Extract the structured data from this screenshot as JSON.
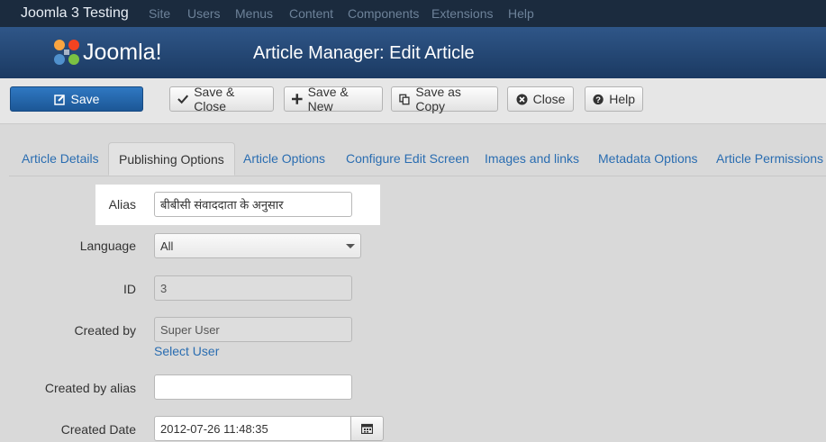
{
  "topnav": {
    "brand": "Joomla 3 Testing",
    "menu": [
      "Site",
      "Users",
      "Menus",
      "Content",
      "Components",
      "Extensions",
      "Help"
    ]
  },
  "header": {
    "logo_text": "Joomla!",
    "title": "Article Manager: Edit Article"
  },
  "toolbar": {
    "save": "Save",
    "save_close": "Save & Close",
    "save_new": "Save & New",
    "save_copy": "Save as Copy",
    "close": "Close",
    "help": "Help"
  },
  "tabs": [
    "Article Details",
    "Publishing Options",
    "Article Options",
    "Configure Edit Screen",
    "Images and links",
    "Metadata Options",
    "Article Permissions"
  ],
  "form": {
    "alias": {
      "label": "Alias",
      "value": "बीबीसी संवाददाता के अनुसार"
    },
    "language": {
      "label": "Language",
      "value": "All"
    },
    "id": {
      "label": "ID",
      "value": "3"
    },
    "created_by": {
      "label": "Created by",
      "value": "Super User",
      "link": "Select User"
    },
    "created_by_alias": {
      "label": "Created by alias",
      "value": ""
    },
    "created_date": {
      "label": "Created Date",
      "value": "2012-07-26 11:48:35"
    }
  },
  "colors": {
    "accent": "#2a6db1",
    "header": "#2f5688",
    "topnav": "#1b2b3e"
  }
}
